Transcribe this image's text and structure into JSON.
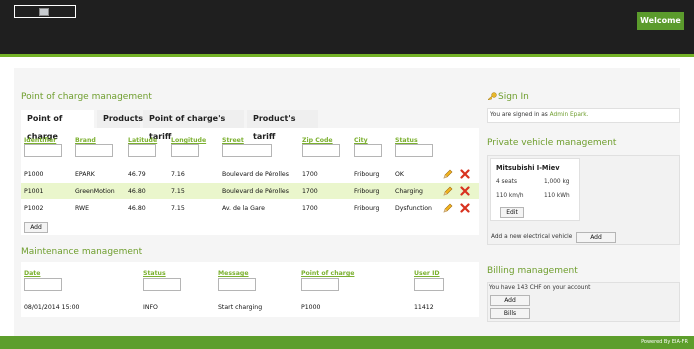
{
  "header": {
    "welcome_label": "Welcome"
  },
  "poc_section": {
    "title": "Point of charge management",
    "tabs": [
      "Point of charge",
      "Products",
      "Point of charge's tariff",
      "Product's tariff"
    ],
    "columns": [
      "Identifier",
      "Brand",
      "Latitude",
      "Longitude",
      "Street",
      "Zip Code",
      "City",
      "Status"
    ],
    "rows": [
      [
        "P1000",
        "EPARK",
        "46.79",
        "7.16",
        "Boulevard de Pérolles",
        "1700",
        "Fribourg",
        "OK"
      ],
      [
        "P1001",
        "GreenMotion",
        "46.80",
        "7.15",
        "Boulevard de Pérolles",
        "1700",
        "Fribourg",
        "Charging"
      ],
      [
        "P1002",
        "RWE",
        "46.80",
        "7.15",
        "Av. de la Gare",
        "1700",
        "Fribourg",
        "Dysfunction"
      ]
    ],
    "add_label": "Add"
  },
  "maintenance_section": {
    "title": "Maintenance management",
    "columns": [
      "Date",
      "Status",
      "Message",
      "Point of charge",
      "User ID"
    ],
    "rows": [
      [
        "08/01/2014 15:00",
        "INFO",
        "Start charging",
        "P1000",
        "11412"
      ]
    ]
  },
  "sidebar": {
    "sign_in": {
      "title": "Sign In",
      "signed_prefix": "You are signed in as",
      "user_link": "Admin Epark."
    },
    "vehicle": {
      "title": "Private vehicle management",
      "name": "Mitsubishi I-Miev",
      "seats": "4 seats",
      "weight": "1,000 kg",
      "speed": "110 km/h",
      "battery": "110 kWh",
      "edit_label": "Edit",
      "add_text": "Add a new electrical vehicle",
      "add_label": "Add"
    },
    "billing": {
      "title": "Billing management",
      "text": "You have 143 CHF on your account",
      "add_label": "Add",
      "bills_label": "Bills"
    }
  },
  "footer": {
    "text": "Powered By EIA-FR"
  },
  "colors": {
    "header_bg": "#1f1f1f",
    "accent_green": "#5b9b2c",
    "title_green": "#6f9e2e",
    "row_highlight": "#eaf6cc",
    "delete_red": "#d8321f"
  }
}
